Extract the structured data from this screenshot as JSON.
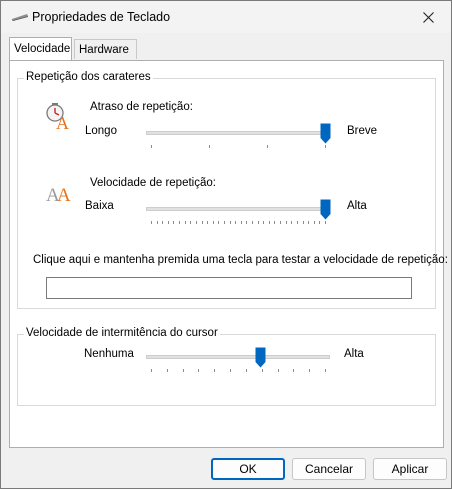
{
  "window": {
    "title": "Propriedades de Teclado",
    "close_icon": "close-icon",
    "keyboard_icon": "keyboard-icon"
  },
  "tabs": [
    {
      "label": "Velocidade",
      "selected": true
    },
    {
      "label": "Hardware",
      "selected": false
    }
  ],
  "repetition_group": {
    "title": "Repetição dos carateres",
    "delay": {
      "icon": "repeat-delay-icon",
      "label": "Atraso de repetição:",
      "min_label": "Longo",
      "max_label": "Breve",
      "value": 1.0,
      "ticks": 4
    },
    "rate": {
      "icon": "repeat-rate-icon",
      "label": "Velocidade de repetição:",
      "min_label": "Baixa",
      "max_label": "Alta",
      "value": 1.0,
      "ticks": 32
    },
    "test_prompt": "Clique aqui e mantenha premida uma tecla para testar a velocidade de repetição:",
    "test_value": ""
  },
  "cursor_group": {
    "title": "Velocidade de intermitência do cursor",
    "min_label": "Nenhuma",
    "max_label": "Alta",
    "value": 0.63,
    "ticks": 12
  },
  "buttons": {
    "ok": "OK",
    "cancel": "Cancelar",
    "apply": "Aplicar"
  },
  "colors": {
    "accent": "#0067c0",
    "icon_orange": "#e8731a"
  }
}
